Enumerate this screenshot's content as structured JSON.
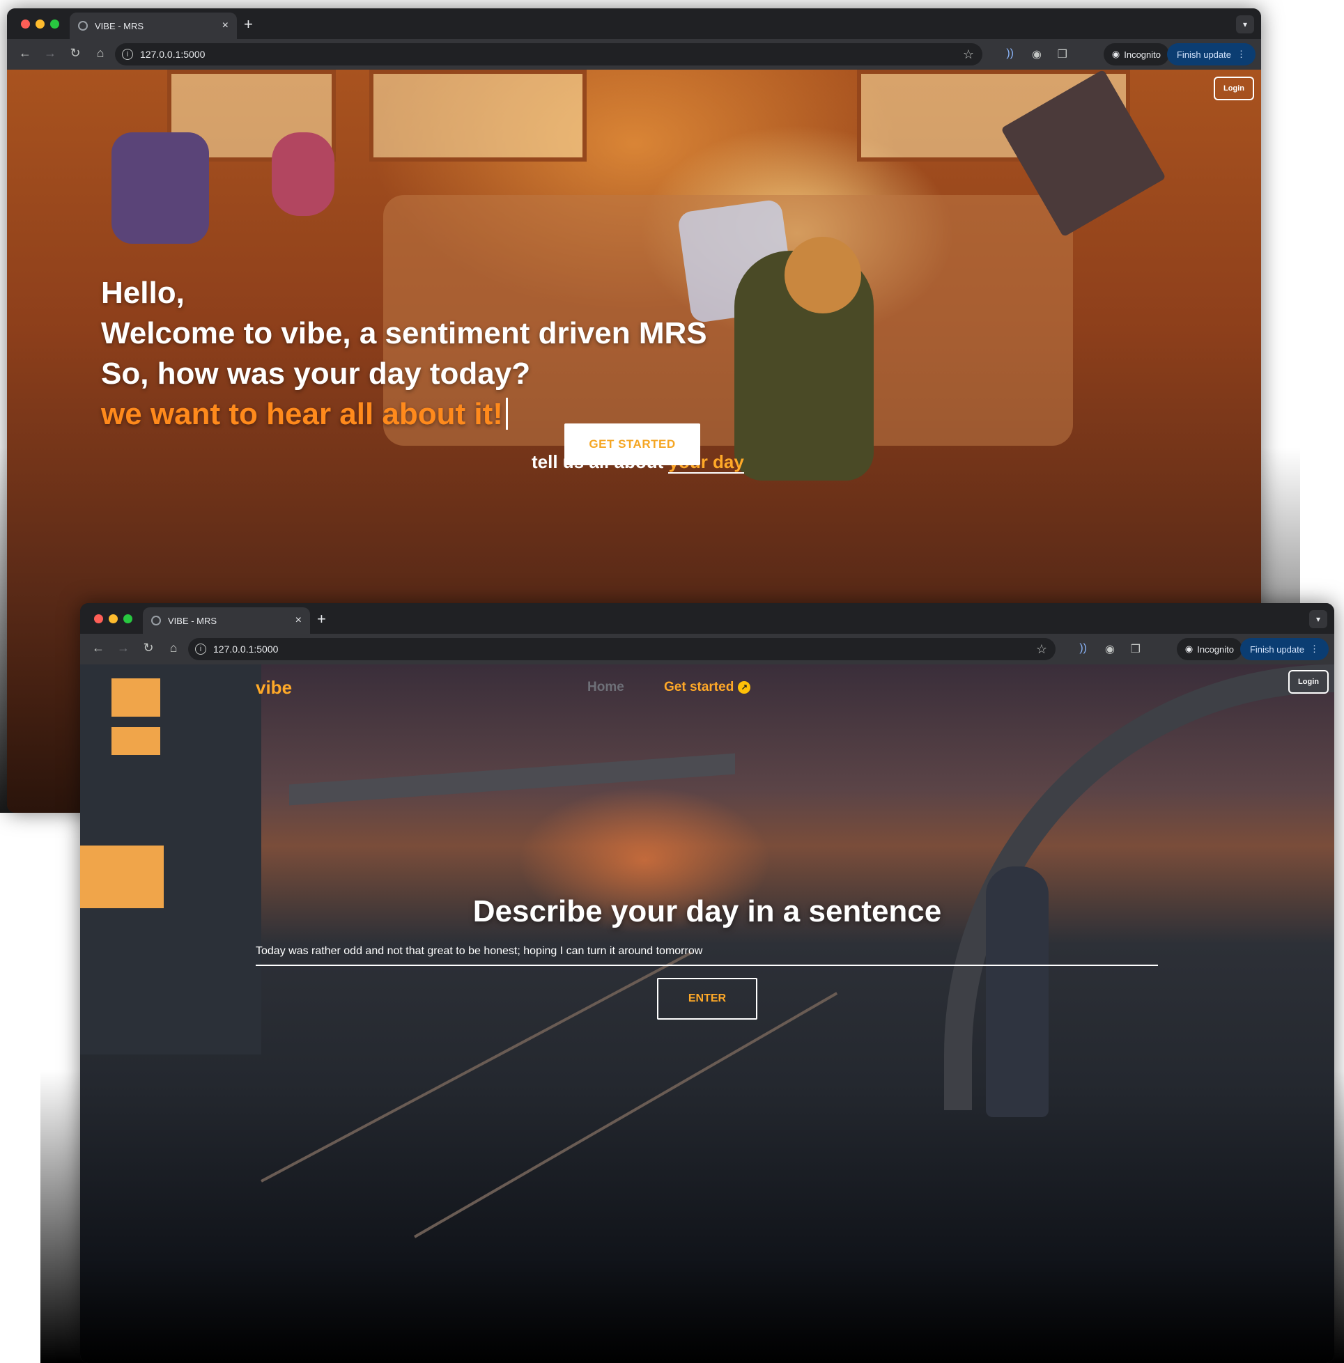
{
  "browser": {
    "tab_title": "VIBE - MRS",
    "url": "127.0.0.1:5000",
    "incognito_label": "Incognito",
    "update_label": "Finish update",
    "new_tab": "+",
    "tab_close": "×",
    "menu_dots": "⋮"
  },
  "landing": {
    "login_label": "Login",
    "greeting": "Hello,",
    "welcome": "Welcome to vibe, a sentiment driven MRS",
    "question": "So, how was your day today?",
    "highlight": "we want to hear all about it!",
    "tell_prefix": "tell us all about",
    "tell_highlight": "your day",
    "cta_label": "GET STARTED"
  },
  "describe_page": {
    "brand": "vibe",
    "nav_home": "Home",
    "nav_get_started": "Get started",
    "login_label": "Login",
    "heading": "Describe your day in a sentence",
    "input_value": "Today was rather odd and not that great to be honest; hoping I can turn it around tomorrow",
    "enter_label": "ENTER"
  },
  "colors": {
    "accent_orange": "#ff8a1c",
    "accent_yellow": "#ffa928",
    "update_blue": "#0b3d72"
  }
}
